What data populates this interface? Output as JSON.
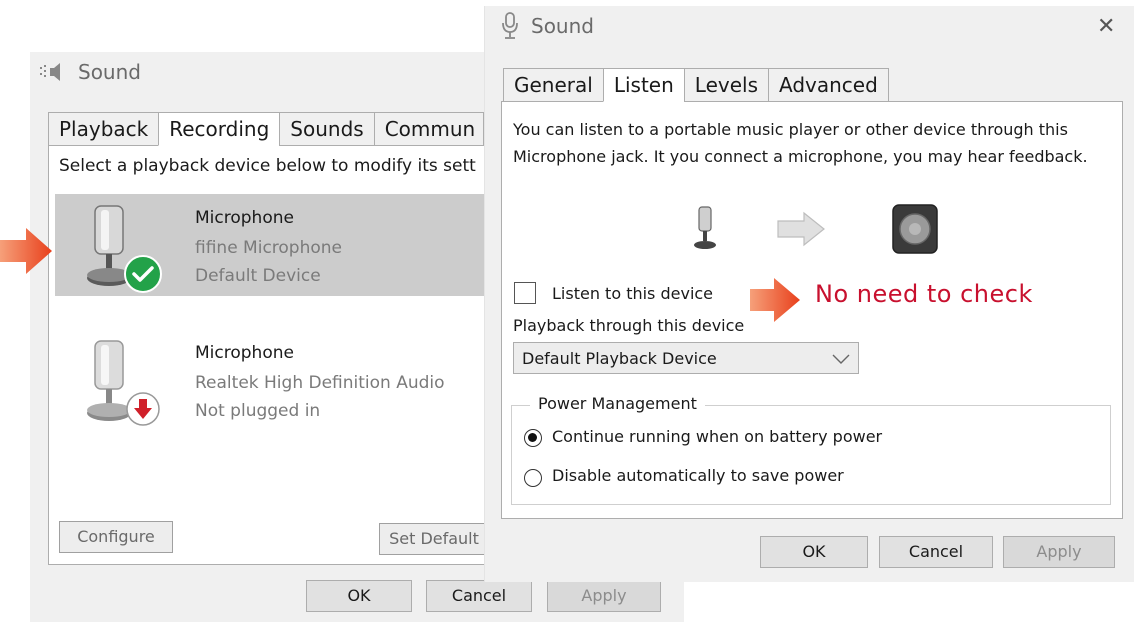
{
  "back_window": {
    "title": "Sound",
    "tabs": [
      {
        "label": "Playback"
      },
      {
        "label": "Recording",
        "active": true
      },
      {
        "label": "Sounds"
      },
      {
        "label": "Commun"
      }
    ],
    "instruction": "Select a playback device below to modify its sett",
    "devices": [
      {
        "name": "Microphone",
        "line1": "fifine Microphone",
        "line2": "Default Device",
        "status": "default",
        "selected": true
      },
      {
        "name": "Microphone",
        "line1": "Realtek High Definition Audio",
        "line2": "Not plugged in",
        "status": "unplugged",
        "selected": false
      }
    ],
    "configure_label": "Configure",
    "set_default_label": "Set Default",
    "ok_label": "OK",
    "cancel_label": "Cancel",
    "apply_label": "Apply"
  },
  "front_window": {
    "title": "Sound",
    "close_glyph": "✕",
    "tabs": [
      {
        "label": "General"
      },
      {
        "label": "Listen",
        "active": true
      },
      {
        "label": "Levels"
      },
      {
        "label": "Advanced"
      }
    ],
    "description": "You can listen to a portable music player or other device through this Microphone jack. It you connect a microphone, you may hear feedback.",
    "listen_checkbox_label": "Listen to this device",
    "listen_checked": false,
    "playback_label": "Playback through this device",
    "playback_value": "Default Playback Device",
    "power_group_label": "Power Management",
    "power_options": [
      {
        "label": "Continue running when on battery power",
        "selected": true
      },
      {
        "label": "Disable automatically to save power",
        "selected": false
      }
    ],
    "ok_label": "OK",
    "cancel_label": "Cancel",
    "apply_label": "Apply"
  },
  "annotation": {
    "text": "No need to check",
    "color": "#c8102e",
    "arrow_color": "#e8401c"
  },
  "colors": {
    "check_green": "#23a249",
    "unplug_red": "#d0202a"
  }
}
